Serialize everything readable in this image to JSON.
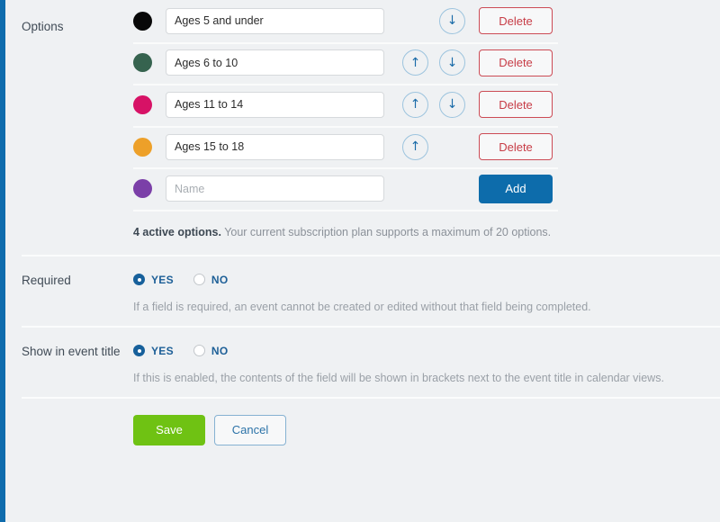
{
  "accent": {
    "left_bar": "#0f6cad",
    "page_bg": "#eff1f3",
    "primary_blue": "#0d6cab",
    "danger_red": "#c73c46",
    "save_green": "#6fc213",
    "radio_blue": "#1d5f97"
  },
  "sections": {
    "options": {
      "label": "Options",
      "note_bold": "4 active options.",
      "note_rest": " Your current subscription plan supports a maximum of 20 options.",
      "name_placeholder": "Name",
      "rows": [
        {
          "color": "#080808",
          "value": "Ages 5 and under",
          "up": false,
          "down": true,
          "action": "Delete"
        },
        {
          "color": "#36634f",
          "value": "Ages 6 to 10",
          "up": true,
          "down": true,
          "action": "Delete"
        },
        {
          "color": "#d71266",
          "value": "Ages 11 to 14",
          "up": true,
          "down": true,
          "action": "Delete"
        },
        {
          "color": "#eda029",
          "value": "Ages 15 to 18",
          "up": true,
          "down": false,
          "action": "Delete"
        },
        {
          "color": "#7b3fa8",
          "value": "",
          "up": false,
          "down": false,
          "action": "Add"
        }
      ],
      "up_arrow_glyph": "↑",
      "down_arrow_glyph": "↓"
    },
    "required": {
      "label": "Required",
      "yes_label": "YES",
      "no_label": "NO",
      "selected": "YES",
      "help": "If a field is required, an event cannot be created or edited without that field being completed."
    },
    "show_in_event_title": {
      "label": "Show in event title",
      "yes_label": "YES",
      "no_label": "NO",
      "selected": "YES",
      "help": "If this is enabled, the contents of the field will be shown in brackets next to the event title in calendar views."
    },
    "footer": {
      "save_label": "Save",
      "cancel_label": "Cancel"
    }
  }
}
